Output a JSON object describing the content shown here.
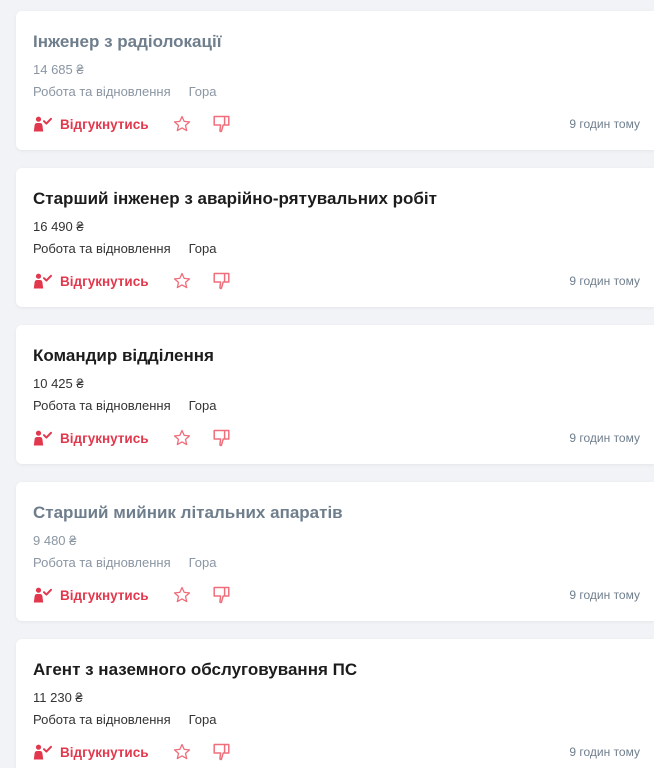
{
  "colors": {
    "accent": "#e2384d",
    "visited_title": "#6f7e8c",
    "background": "#f1f3f6"
  },
  "icons": {
    "respond": "person-check-icon",
    "favorite": "star-outline-icon",
    "dislike": "thumb-down-icon"
  },
  "jobs": [
    {
      "title": "Інженер з радіолокації",
      "visited": true,
      "salary": "14 685 ₴",
      "company": "Робота та відновлення",
      "city": "Гора",
      "respond_label": "Відгукнутись",
      "time": "9 годин тому"
    },
    {
      "title": "Старший інженер з аварійно-рятувальних робіт",
      "visited": false,
      "salary": "16 490 ₴",
      "company": "Робота та відновлення",
      "city": "Гора",
      "respond_label": "Відгукнутись",
      "time": "9 годин тому"
    },
    {
      "title": "Командир відділення",
      "visited": false,
      "salary": "10 425 ₴",
      "company": "Робота та відновлення",
      "city": "Гора",
      "respond_label": "Відгукнутись",
      "time": "9 годин тому"
    },
    {
      "title": "Старший мийник літальних апаратів",
      "visited": true,
      "salary": "9 480 ₴",
      "company": "Робота та відновлення",
      "city": "Гора",
      "respond_label": "Відгукнутись",
      "time": "9 годин тому"
    },
    {
      "title": "Агент з наземного обслуговування ПС",
      "visited": false,
      "salary": "11 230 ₴",
      "company": "Робота та відновлення",
      "city": "Гора",
      "respond_label": "Відгукнутись",
      "time": "9 годин тому"
    }
  ]
}
